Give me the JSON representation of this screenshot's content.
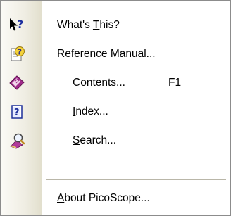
{
  "menu": {
    "items": [
      {
        "pre": "What's ",
        "key": "T",
        "post": "his?",
        "icon": "whats-this-icon"
      },
      {
        "pre": "",
        "key": "R",
        "post": "eference Manual...",
        "icon": "reference-manual-icon"
      },
      {
        "pre": "",
        "key": "C",
        "post": "ontents...",
        "shortcut": "F1",
        "icon": "contents-book-icon"
      },
      {
        "pre": "",
        "key": "I",
        "post": "ndex...",
        "icon": "index-help-icon"
      },
      {
        "pre": "",
        "key": "S",
        "post": "earch...",
        "icon": "search-icon"
      },
      {
        "pre": "",
        "key": "A",
        "post": "bout PicoScope...",
        "icon": null
      }
    ]
  },
  "colors": {
    "border": "#8c8c8c",
    "gutter_light": "#fbfaf6",
    "gutter_dark": "#e2dfcd"
  }
}
